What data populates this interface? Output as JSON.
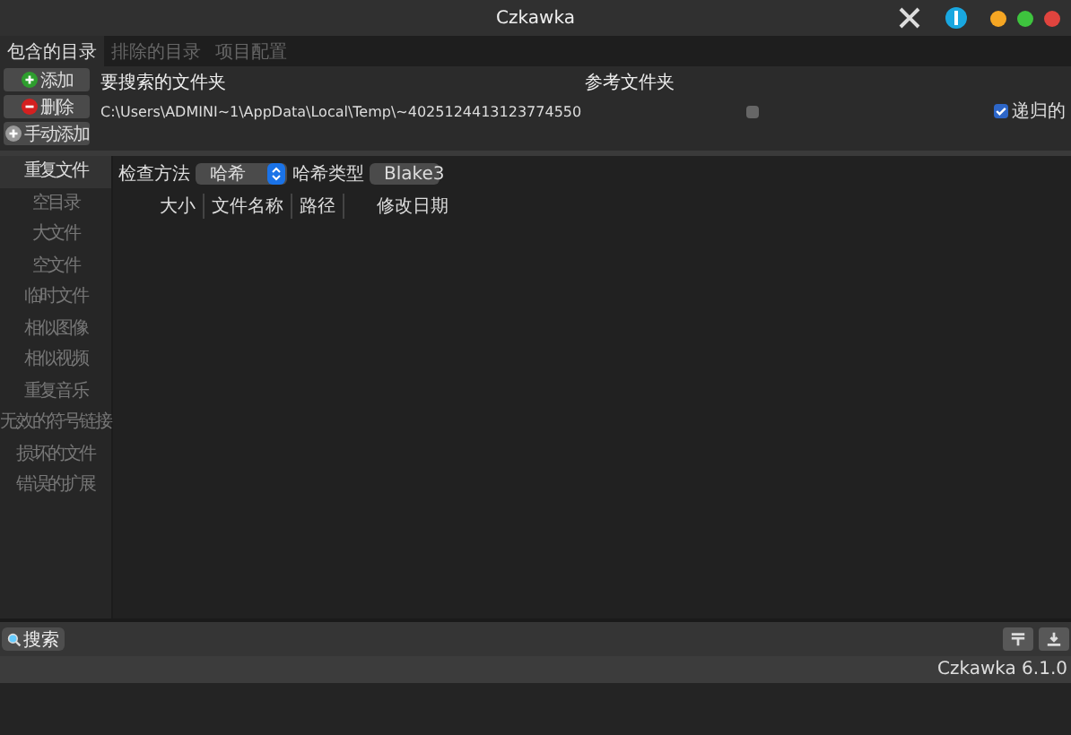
{
  "window": {
    "title": "Czkawka"
  },
  "tabs": [
    {
      "label": "包含的目录",
      "selected": true
    },
    {
      "label": "排除的目录",
      "selected": false
    },
    {
      "label": "项目配置",
      "selected": false
    }
  ],
  "dir_buttons": [
    {
      "label": "添加",
      "kind": "add"
    },
    {
      "label": "删除",
      "kind": "remove"
    },
    {
      "label": "手动添加",
      "kind": "manual"
    }
  ],
  "dir_table": {
    "columns": [
      "要搜索的文件夹",
      "参考文件夹"
    ],
    "rows": [
      {
        "path": "C:\\Users\\ADMINI~1\\AppData\\Local\\Temp\\~4025124413123774550",
        "reference": false
      }
    ]
  },
  "recursive": {
    "label": "递归的",
    "checked": true
  },
  "sidebar": {
    "items": [
      {
        "label": "重复文件",
        "selected": true
      },
      {
        "label": "空目录",
        "selected": false
      },
      {
        "label": "大文件",
        "selected": false
      },
      {
        "label": "空文件",
        "selected": false
      },
      {
        "label": "临时文件",
        "selected": false
      },
      {
        "label": "相似图像",
        "selected": false
      },
      {
        "label": "相似视频",
        "selected": false
      },
      {
        "label": "重复音乐",
        "selected": false
      },
      {
        "label": "无效的符号链接",
        "selected": false
      },
      {
        "label": "损坏的文件",
        "selected": false
      },
      {
        "label": "错误的扩展",
        "selected": false
      }
    ]
  },
  "options": [
    {
      "label": "检查方法",
      "value": "哈希"
    },
    {
      "label": "哈希类型",
      "value": "Blake3"
    }
  ],
  "results": {
    "columns": [
      "大小",
      "文件名称",
      "路径",
      "修改日期"
    ]
  },
  "search_button": "搜索",
  "status_bar": "Czkawka 6.1.0"
}
